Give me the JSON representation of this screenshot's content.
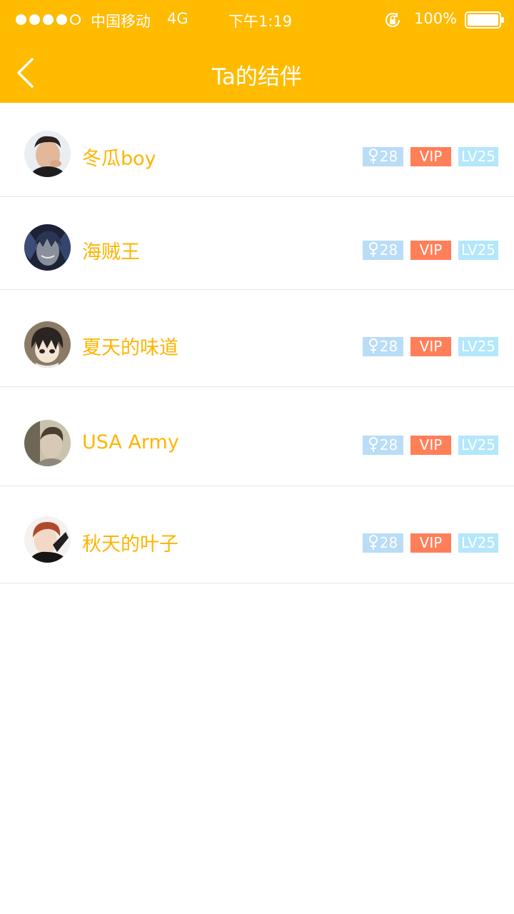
{
  "status_bar": {
    "signal_filled": 4,
    "signal_total": 5,
    "carrier": "中国移动",
    "network": "4G",
    "time": "下午1:19",
    "battery": "100%"
  },
  "header": {
    "title": "Ta的结伴",
    "back_icon": "chevron-left-icon",
    "background_color": "#FFBB00"
  },
  "companions": [
    {
      "name": "冬瓜boy",
      "gender_icon": "female-icon",
      "age": "28",
      "vip": "VIP",
      "level": "LV25"
    },
    {
      "name": "海贼王",
      "gender_icon": "female-icon",
      "age": "28",
      "vip": "VIP",
      "level": "LV25"
    },
    {
      "name": "夏天的味道",
      "gender_icon": "female-icon",
      "age": "28",
      "vip": "VIP",
      "level": "LV25"
    },
    {
      "name": "USA Army",
      "gender_icon": "female-icon",
      "age": "28",
      "vip": "VIP",
      "level": "LV25"
    },
    {
      "name": "秋天的叶子",
      "gender_icon": "female-icon",
      "age": "28",
      "vip": "VIP",
      "level": "LV25"
    }
  ],
  "colors": {
    "accent": "#FFBB00",
    "name_text": "#FFB400",
    "age_badge": "#B9DCF7",
    "vip_badge": "#FF7F58",
    "level_badge": "#B4E7FB"
  }
}
